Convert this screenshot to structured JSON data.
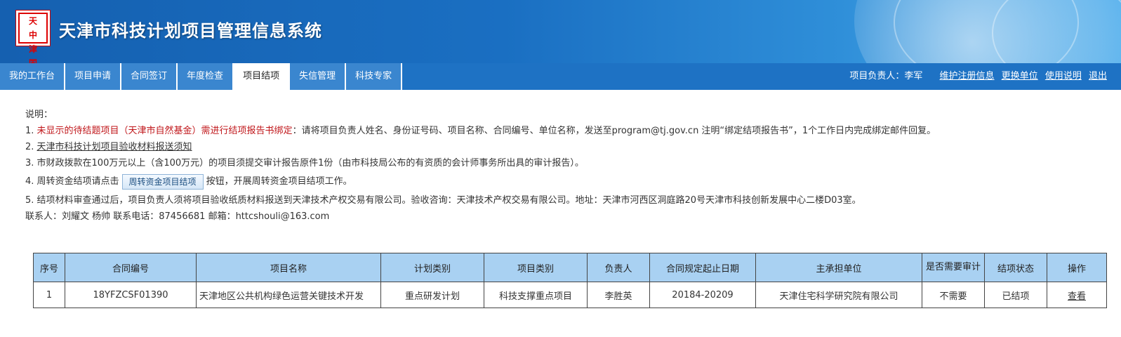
{
  "header": {
    "logo_chars": [
      "天",
      "中",
      "津",
      "国"
    ],
    "title": "天津市科技计划项目管理信息系统"
  },
  "nav": {
    "tabs": [
      {
        "label": "我的工作台",
        "active": false
      },
      {
        "label": "项目申请",
        "active": false
      },
      {
        "label": "合同签订",
        "active": false
      },
      {
        "label": "年度检查",
        "active": false
      },
      {
        "label": "项目结项",
        "active": true
      },
      {
        "label": "失信管理",
        "active": false
      },
      {
        "label": "科技专家",
        "active": false
      }
    ],
    "user_label": "项目负责人：",
    "user_name": "李军",
    "links": [
      "维护注册信息",
      "更换单位",
      "使用说明",
      "退出"
    ]
  },
  "notes": {
    "heading": "说明：",
    "line1_prefix": "1. ",
    "line1_red": "未显示的待结题项目（天津市自然基金）需进行结项报告书绑定",
    "line1_rest": "：请将项目负责人姓名、身份证号码、项目名称、合同编号、单位名称，发送至program@tj.gov.cn 注明“绑定结项报告书”，1个工作日内完成绑定邮件回复。",
    "line2_prefix": "2. ",
    "line2_link": "天津市科技计划项目验收材料报送须知",
    "line3": "3. 市财政拨款在100万元以上（含100万元）的项目须提交审计报告原件1份（由市科技局公布的有资质的会计师事务所出具的审计报告）。",
    "line4_prefix": "4. 周转资金结项请点击",
    "line4_button": "周转资金项目结项",
    "line4_suffix": "按钮，开展周转资金项目结项工作。",
    "line5": "5. 结项材料审查通过后，项目负责人须将项目验收纸质材料报送到天津技术产权交易有限公司。验收咨询：天津技术产权交易有限公司。地址：天津市河西区洞庭路20号天津市科技创新发展中心二楼D03室。",
    "contact": "联系人：刘耀文 杨帅 联系电话：87456681 邮箱：httcshouli@163.com"
  },
  "table": {
    "headers": [
      "序号",
      "合同编号",
      "项目名称",
      "计划类别",
      "项目类别",
      "负责人",
      "合同规定起止日期",
      "主承担单位",
      "是否需要审计",
      "结项状态",
      "操作"
    ],
    "rows": [
      [
        "1",
        "18YFZCSF01390",
        "天津地区公共机构绿色运营关键技术开发",
        "重点研发计划",
        "科技支撑重点项目",
        "李胜英",
        "20184-20209",
        "天津住宅科学研究院有限公司",
        "不需要",
        "已结项",
        "查看"
      ]
    ]
  }
}
